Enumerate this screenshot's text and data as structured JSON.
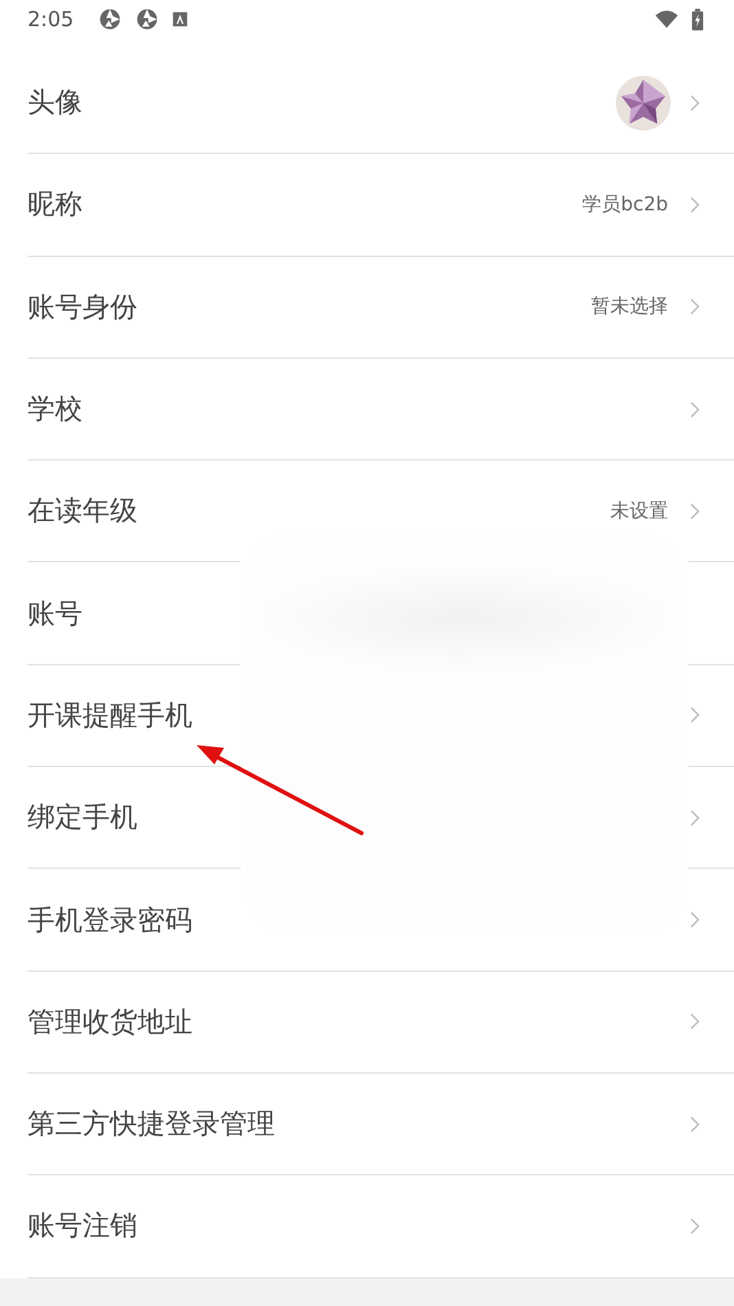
{
  "status_bar": {
    "time": "2:05"
  },
  "rows": [
    {
      "label": "头像",
      "kind": "avatar",
      "chevron": true
    },
    {
      "label": "昵称",
      "kind": "value",
      "value": "学员bc2b",
      "chevron": true
    },
    {
      "label": "账号身份",
      "kind": "value",
      "value": "暂未选择",
      "chevron": true
    },
    {
      "label": "学校",
      "kind": "plain",
      "chevron": true
    },
    {
      "label": "在读年级",
      "kind": "value",
      "value": "未设置",
      "chevron": true
    },
    {
      "label": "账号",
      "kind": "plain",
      "chevron": false
    },
    {
      "label": "开课提醒手机",
      "kind": "plain",
      "chevron": true
    },
    {
      "label": "绑定手机",
      "kind": "plain",
      "chevron": true
    },
    {
      "label": "手机登录密码",
      "kind": "plain",
      "chevron": true
    },
    {
      "label": "管理收货地址",
      "kind": "plain",
      "chevron": true
    },
    {
      "label": "第三方快捷登录管理",
      "kind": "plain",
      "chevron": true
    },
    {
      "label": "账号注销",
      "kind": "plain",
      "chevron": true
    }
  ]
}
